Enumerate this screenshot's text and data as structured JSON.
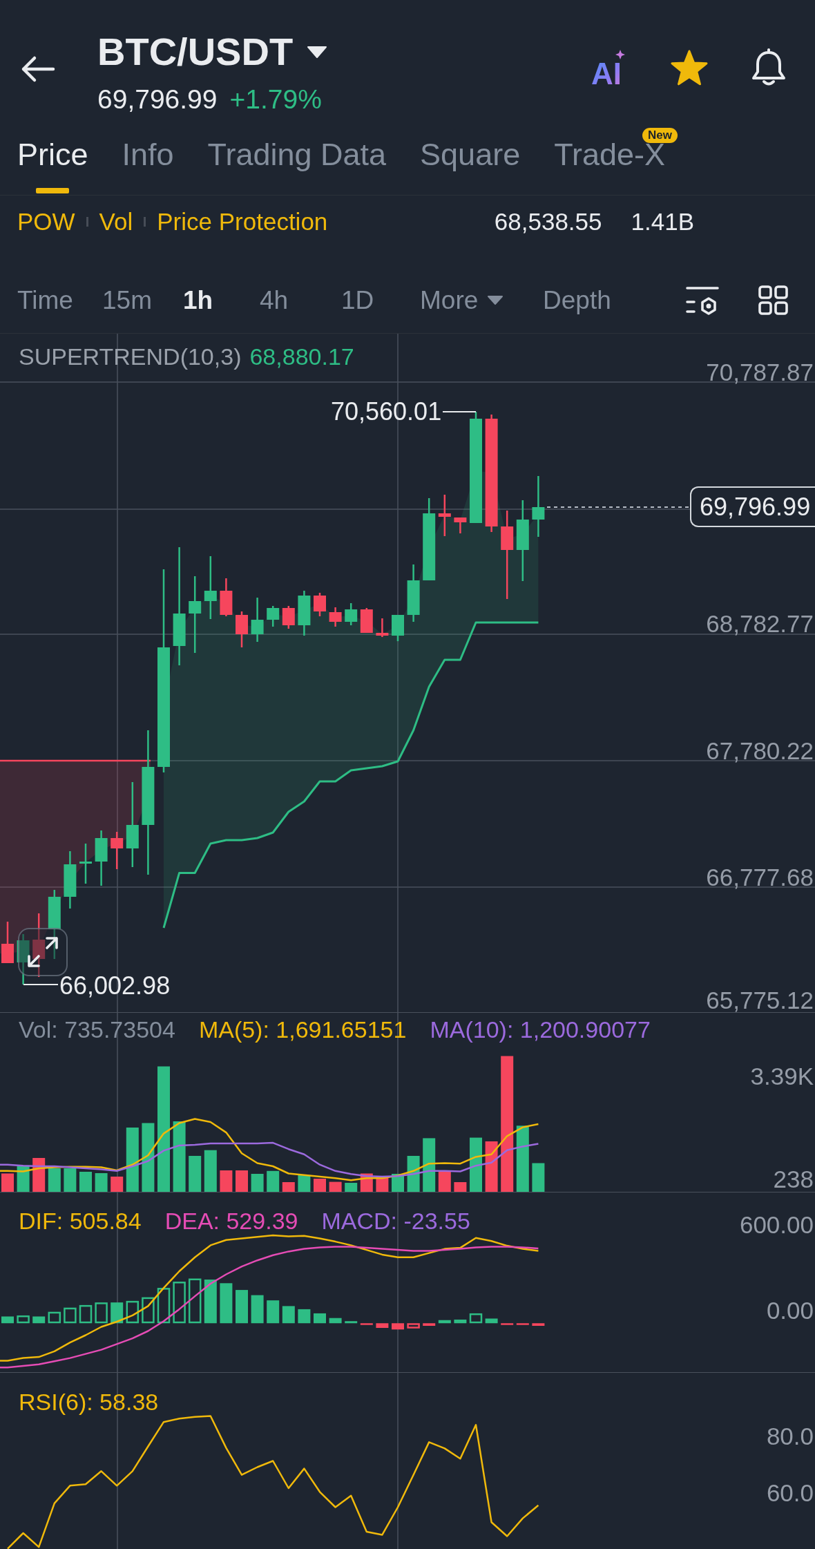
{
  "header": {
    "title": "BTC/USDT",
    "last_price": "69,796.99",
    "change": "+1.79%",
    "ai_label": "AI",
    "starred": true
  },
  "tabs": [
    {
      "label": "Price",
      "selected": true
    },
    {
      "label": "Info",
      "selected": false
    },
    {
      "label": "Trading Data",
      "selected": false
    },
    {
      "label": "Square",
      "selected": false
    },
    {
      "label": "Trade-X",
      "selected": false,
      "badge": "New"
    }
  ],
  "market_info": {
    "tags": [
      "POW",
      "Vol",
      "Price Protection"
    ],
    "stats": [
      "68,538.55",
      "1.41B"
    ]
  },
  "intervals": [
    {
      "label": "Time",
      "kind": "option",
      "selected": false
    },
    {
      "label": "15m",
      "kind": "option",
      "selected": false
    },
    {
      "label": "1h",
      "kind": "option",
      "selected": true
    },
    {
      "label": "4h",
      "kind": "option",
      "selected": false
    },
    {
      "label": "1D",
      "kind": "option",
      "selected": false
    },
    {
      "label": "More",
      "kind": "dropdown",
      "selected": false
    },
    {
      "label": "Depth",
      "kind": "option",
      "selected": false
    }
  ],
  "price_chart": {
    "indicator": {
      "name": "SUPERTREND(10,3)",
      "value": "68,880.17"
    },
    "axis_labels": [
      "70,787.87",
      "68,782.77",
      "67,780.22",
      "66,777.68",
      "65,775.12"
    ],
    "last_price_tag": "69,796.99",
    "high_marker": "70,560.01",
    "low_marker": "66,002.98"
  },
  "volume": {
    "legend": [
      {
        "text": "Vol: 735.73504",
        "color": "#848e9c"
      },
      {
        "text": "MA(5): 1,691.65151",
        "color": "#f0b90b"
      },
      {
        "text": "MA(10): 1,200.90077",
        "color": "#9c6ade"
      }
    ],
    "axis_labels": [
      "3.39K",
      "238"
    ]
  },
  "macd": {
    "legend": [
      {
        "text": "DIF: 505.84",
        "color": "#f0b90b"
      },
      {
        "text": "DEA: 529.39",
        "color": "#e54cb5"
      },
      {
        "text": "MACD: -23.55",
        "color": "#9c6ade"
      }
    ],
    "axis_labels": [
      "600.00",
      "0.00"
    ]
  },
  "rsi": {
    "legend": "RSI(6): 58.38",
    "axis_labels": [
      "80.0",
      "60.0"
    ]
  }
}
